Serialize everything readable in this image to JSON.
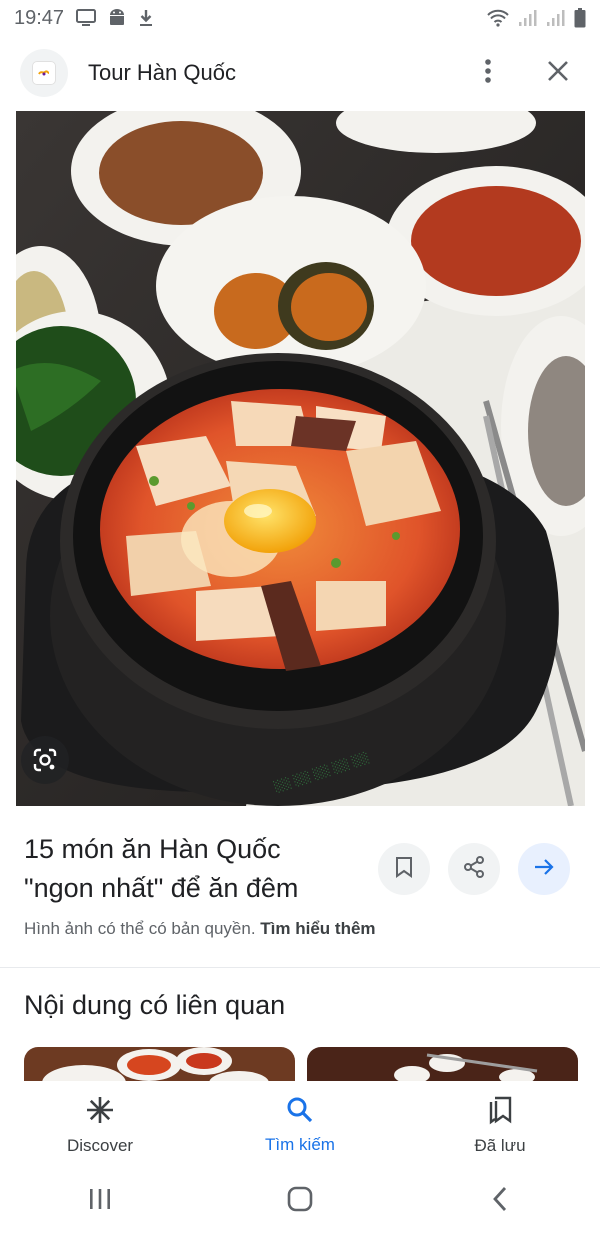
{
  "status_bar": {
    "time": "19:47",
    "icons": [
      "screen-cast-icon",
      "android-icon",
      "download-icon",
      "wifi-icon",
      "signal-icon",
      "signal-icon",
      "battery-icon"
    ]
  },
  "header": {
    "title": "Tour Hàn Quốc",
    "more_icon": "more-vert-icon",
    "close_icon": "close-icon"
  },
  "result": {
    "title": "15 món ăn Hàn Quốc \"ngon nhất\" để ăn đêm",
    "copyright_text": "Hình ảnh có thể có bản quyền.",
    "learn_more": "Tìm hiểu thêm"
  },
  "related": {
    "heading": "Nội dung có liên quan"
  },
  "bottom_nav": {
    "items": [
      {
        "label": "Discover",
        "icon": "asterisk-icon",
        "active": false
      },
      {
        "label": "Tìm kiếm",
        "icon": "search-icon",
        "active": true
      },
      {
        "label": "Đã lưu",
        "icon": "saved-icon",
        "active": false
      }
    ]
  },
  "colors": {
    "accent": "#1a73e8",
    "text": "#202124",
    "muted": "#5f6368",
    "button_bg": "#f1f3f4"
  }
}
